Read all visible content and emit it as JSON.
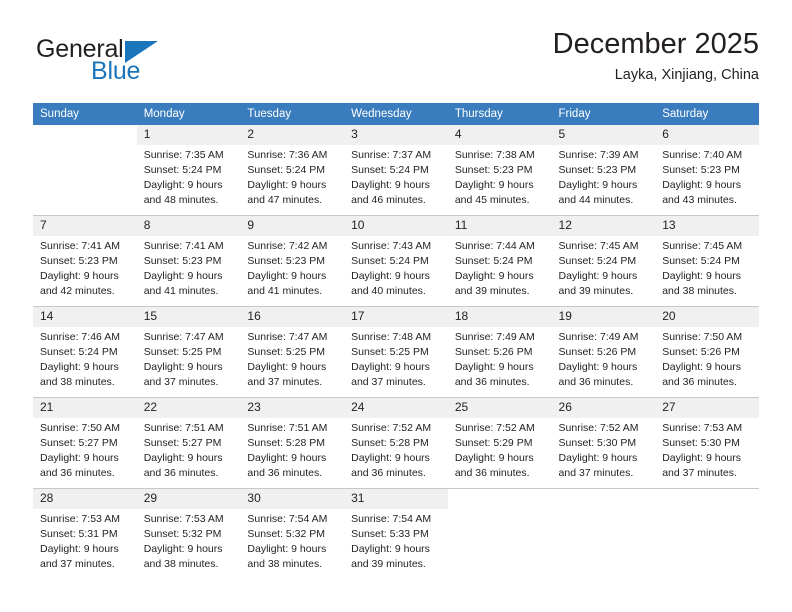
{
  "brand": {
    "name_part1": "General",
    "name_part2": "Blue",
    "accent_color": "#1b75bb"
  },
  "header": {
    "title": "December 2025",
    "subtitle": "Layka, Xinjiang, China"
  },
  "calendar": {
    "header_bg": "#3a7dbf",
    "daynum_bg": "#f0f0f0",
    "weekdays": [
      "Sunday",
      "Monday",
      "Tuesday",
      "Wednesday",
      "Thursday",
      "Friday",
      "Saturday"
    ],
    "weeks": [
      [
        {
          "day": "",
          "empty": true
        },
        {
          "day": "1",
          "sunrise": "Sunrise: 7:35 AM",
          "sunset": "Sunset: 5:24 PM",
          "daylight1": "Daylight: 9 hours",
          "daylight2": "and 48 minutes."
        },
        {
          "day": "2",
          "sunrise": "Sunrise: 7:36 AM",
          "sunset": "Sunset: 5:24 PM",
          "daylight1": "Daylight: 9 hours",
          "daylight2": "and 47 minutes."
        },
        {
          "day": "3",
          "sunrise": "Sunrise: 7:37 AM",
          "sunset": "Sunset: 5:24 PM",
          "daylight1": "Daylight: 9 hours",
          "daylight2": "and 46 minutes."
        },
        {
          "day": "4",
          "sunrise": "Sunrise: 7:38 AM",
          "sunset": "Sunset: 5:23 PM",
          "daylight1": "Daylight: 9 hours",
          "daylight2": "and 45 minutes."
        },
        {
          "day": "5",
          "sunrise": "Sunrise: 7:39 AM",
          "sunset": "Sunset: 5:23 PM",
          "daylight1": "Daylight: 9 hours",
          "daylight2": "and 44 minutes."
        },
        {
          "day": "6",
          "sunrise": "Sunrise: 7:40 AM",
          "sunset": "Sunset: 5:23 PM",
          "daylight1": "Daylight: 9 hours",
          "daylight2": "and 43 minutes."
        }
      ],
      [
        {
          "day": "7",
          "sunrise": "Sunrise: 7:41 AM",
          "sunset": "Sunset: 5:23 PM",
          "daylight1": "Daylight: 9 hours",
          "daylight2": "and 42 minutes."
        },
        {
          "day": "8",
          "sunrise": "Sunrise: 7:41 AM",
          "sunset": "Sunset: 5:23 PM",
          "daylight1": "Daylight: 9 hours",
          "daylight2": "and 41 minutes."
        },
        {
          "day": "9",
          "sunrise": "Sunrise: 7:42 AM",
          "sunset": "Sunset: 5:23 PM",
          "daylight1": "Daylight: 9 hours",
          "daylight2": "and 41 minutes."
        },
        {
          "day": "10",
          "sunrise": "Sunrise: 7:43 AM",
          "sunset": "Sunset: 5:24 PM",
          "daylight1": "Daylight: 9 hours",
          "daylight2": "and 40 minutes."
        },
        {
          "day": "11",
          "sunrise": "Sunrise: 7:44 AM",
          "sunset": "Sunset: 5:24 PM",
          "daylight1": "Daylight: 9 hours",
          "daylight2": "and 39 minutes."
        },
        {
          "day": "12",
          "sunrise": "Sunrise: 7:45 AM",
          "sunset": "Sunset: 5:24 PM",
          "daylight1": "Daylight: 9 hours",
          "daylight2": "and 39 minutes."
        },
        {
          "day": "13",
          "sunrise": "Sunrise: 7:45 AM",
          "sunset": "Sunset: 5:24 PM",
          "daylight1": "Daylight: 9 hours",
          "daylight2": "and 38 minutes."
        }
      ],
      [
        {
          "day": "14",
          "sunrise": "Sunrise: 7:46 AM",
          "sunset": "Sunset: 5:24 PM",
          "daylight1": "Daylight: 9 hours",
          "daylight2": "and 38 minutes."
        },
        {
          "day": "15",
          "sunrise": "Sunrise: 7:47 AM",
          "sunset": "Sunset: 5:25 PM",
          "daylight1": "Daylight: 9 hours",
          "daylight2": "and 37 minutes."
        },
        {
          "day": "16",
          "sunrise": "Sunrise: 7:47 AM",
          "sunset": "Sunset: 5:25 PM",
          "daylight1": "Daylight: 9 hours",
          "daylight2": "and 37 minutes."
        },
        {
          "day": "17",
          "sunrise": "Sunrise: 7:48 AM",
          "sunset": "Sunset: 5:25 PM",
          "daylight1": "Daylight: 9 hours",
          "daylight2": "and 37 minutes."
        },
        {
          "day": "18",
          "sunrise": "Sunrise: 7:49 AM",
          "sunset": "Sunset: 5:26 PM",
          "daylight1": "Daylight: 9 hours",
          "daylight2": "and 36 minutes."
        },
        {
          "day": "19",
          "sunrise": "Sunrise: 7:49 AM",
          "sunset": "Sunset: 5:26 PM",
          "daylight1": "Daylight: 9 hours",
          "daylight2": "and 36 minutes."
        },
        {
          "day": "20",
          "sunrise": "Sunrise: 7:50 AM",
          "sunset": "Sunset: 5:26 PM",
          "daylight1": "Daylight: 9 hours",
          "daylight2": "and 36 minutes."
        }
      ],
      [
        {
          "day": "21",
          "sunrise": "Sunrise: 7:50 AM",
          "sunset": "Sunset: 5:27 PM",
          "daylight1": "Daylight: 9 hours",
          "daylight2": "and 36 minutes."
        },
        {
          "day": "22",
          "sunrise": "Sunrise: 7:51 AM",
          "sunset": "Sunset: 5:27 PM",
          "daylight1": "Daylight: 9 hours",
          "daylight2": "and 36 minutes."
        },
        {
          "day": "23",
          "sunrise": "Sunrise: 7:51 AM",
          "sunset": "Sunset: 5:28 PM",
          "daylight1": "Daylight: 9 hours",
          "daylight2": "and 36 minutes."
        },
        {
          "day": "24",
          "sunrise": "Sunrise: 7:52 AM",
          "sunset": "Sunset: 5:28 PM",
          "daylight1": "Daylight: 9 hours",
          "daylight2": "and 36 minutes."
        },
        {
          "day": "25",
          "sunrise": "Sunrise: 7:52 AM",
          "sunset": "Sunset: 5:29 PM",
          "daylight1": "Daylight: 9 hours",
          "daylight2": "and 36 minutes."
        },
        {
          "day": "26",
          "sunrise": "Sunrise: 7:52 AM",
          "sunset": "Sunset: 5:30 PM",
          "daylight1": "Daylight: 9 hours",
          "daylight2": "and 37 minutes."
        },
        {
          "day": "27",
          "sunrise": "Sunrise: 7:53 AM",
          "sunset": "Sunset: 5:30 PM",
          "daylight1": "Daylight: 9 hours",
          "daylight2": "and 37 minutes."
        }
      ],
      [
        {
          "day": "28",
          "sunrise": "Sunrise: 7:53 AM",
          "sunset": "Sunset: 5:31 PM",
          "daylight1": "Daylight: 9 hours",
          "daylight2": "and 37 minutes."
        },
        {
          "day": "29",
          "sunrise": "Sunrise: 7:53 AM",
          "sunset": "Sunset: 5:32 PM",
          "daylight1": "Daylight: 9 hours",
          "daylight2": "and 38 minutes."
        },
        {
          "day": "30",
          "sunrise": "Sunrise: 7:54 AM",
          "sunset": "Sunset: 5:32 PM",
          "daylight1": "Daylight: 9 hours",
          "daylight2": "and 38 minutes."
        },
        {
          "day": "31",
          "sunrise": "Sunrise: 7:54 AM",
          "sunset": "Sunset: 5:33 PM",
          "daylight1": "Daylight: 9 hours",
          "daylight2": "and 39 minutes."
        },
        {
          "day": "",
          "empty": true
        },
        {
          "day": "",
          "empty": true
        },
        {
          "day": "",
          "empty": true
        }
      ]
    ]
  }
}
